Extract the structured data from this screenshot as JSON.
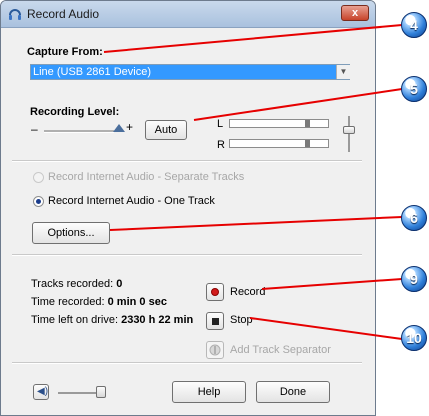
{
  "window": {
    "title": "Record Audio",
    "close_glyph": "x"
  },
  "capture": {
    "label": "Capture From:",
    "selected": "Line (USB 2861 Device)",
    "dropdown_glyph": "▼"
  },
  "recording_level": {
    "label": "Recording Level:",
    "minus": "–",
    "plus": "+",
    "auto_button": "Auto",
    "meter_left_label": "L",
    "meter_right_label": "R",
    "slider_level": 1.0,
    "meter_left_peak": 0.82,
    "meter_right_peak": 0.82
  },
  "mode": {
    "option_separate": "Record Internet Audio - Separate Tracks",
    "option_one": "Record Internet Audio - One Track",
    "selected": "one"
  },
  "options_button": "Options...",
  "stats": {
    "tracks_label": "Tracks recorded: ",
    "tracks_value": "0",
    "time_label": "Time recorded: ",
    "time_value": "0 min 0 sec",
    "left_label": "Time left on drive: ",
    "left_value": "2330 h 22 min"
  },
  "actions": {
    "record": "Record",
    "stop": "Stop",
    "add_separator": "Add Track Separator"
  },
  "footer": {
    "help": "Help",
    "done": "Done",
    "speaker_glyph": "◀)"
  },
  "callouts": [
    {
      "number": "4"
    },
    {
      "number": "5"
    },
    {
      "number": "6"
    },
    {
      "number": "9"
    },
    {
      "number": "10"
    }
  ],
  "colors": {
    "accent": "#3399ff",
    "callout_line": "#e60000",
    "record_dot": "#d11a1a"
  }
}
